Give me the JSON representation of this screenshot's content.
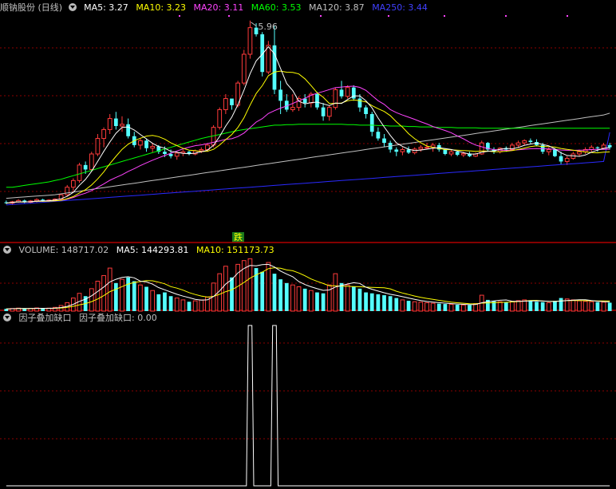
{
  "price_legend": {
    "title": "顺钠股份 (日线)",
    "ma5": "MA5: 3.27",
    "ma10": "MA10: 3.23",
    "ma20": "MA20: 3.11",
    "ma60": "MA60: 3.53",
    "ma120": "MA120: 3.87",
    "ma250": "MA250: 3.44"
  },
  "volume_legend": {
    "title": "VOLUME: 148717.02",
    "ma5": "MA5: 144293.81",
    "ma10": "MA10: 151173.73"
  },
  "factor_legend": {
    "title": "因子叠加缺口",
    "value": "因子叠加缺口: 0.00"
  },
  "annotations": {
    "peak_label": "5.96",
    "die_badge": "跌"
  },
  "colors": {
    "up": "#ff3b3b",
    "down": "#54ffff",
    "ma5": "#ffffff",
    "ma10": "#ffff00",
    "ma20": "#ff44ff",
    "ma60": "#00ff00",
    "ma120": "#c0c0c0",
    "ma250": "#2a2aff",
    "grid": "#8b0000"
  },
  "chart_data": [
    {
      "type": "candlestick",
      "title": "顺钠股份 (日线)",
      "ylim": [
        1.6,
        6.1
      ],
      "peak_high": 5.96,
      "ohlc": [
        [
          1.86,
          1.9,
          1.82,
          1.84
        ],
        [
          1.84,
          1.89,
          1.8,
          1.87
        ],
        [
          1.87,
          1.93,
          1.85,
          1.9
        ],
        [
          1.9,
          1.92,
          1.84,
          1.86
        ],
        [
          1.86,
          1.91,
          1.83,
          1.89
        ],
        [
          1.89,
          1.95,
          1.86,
          1.92
        ],
        [
          1.92,
          1.94,
          1.87,
          1.9
        ],
        [
          1.9,
          1.93,
          1.86,
          1.91
        ],
        [
          1.91,
          1.95,
          1.88,
          1.93
        ],
        [
          1.93,
          2.05,
          1.91,
          2.03
        ],
        [
          2.03,
          2.25,
          2.0,
          2.2
        ],
        [
          2.2,
          2.4,
          2.12,
          2.35
        ],
        [
          2.35,
          2.75,
          2.3,
          2.7
        ],
        [
          2.7,
          2.78,
          2.5,
          2.6
        ],
        [
          2.6,
          3.0,
          2.55,
          2.95
        ],
        [
          2.95,
          3.4,
          2.9,
          3.3
        ],
        [
          3.3,
          3.55,
          3.1,
          3.5
        ],
        [
          3.5,
          3.85,
          3.4,
          3.75
        ],
        [
          3.75,
          3.9,
          3.5,
          3.58
        ],
        [
          3.58,
          3.8,
          3.45,
          3.62
        ],
        [
          3.62,
          3.75,
          3.3,
          3.35
        ],
        [
          3.35,
          3.45,
          3.1,
          3.15
        ],
        [
          3.15,
          3.3,
          3.05,
          3.25
        ],
        [
          3.25,
          3.3,
          3.0,
          3.08
        ],
        [
          3.08,
          3.2,
          2.98,
          3.12
        ],
        [
          3.12,
          3.15,
          2.95,
          3.0
        ],
        [
          3.0,
          3.12,
          2.88,
          2.95
        ],
        [
          2.95,
          3.05,
          2.85,
          2.9
        ],
        [
          2.9,
          3.0,
          2.82,
          2.97
        ],
        [
          2.97,
          3.05,
          2.9,
          3.0
        ],
        [
          3.0,
          3.02,
          2.92,
          2.95
        ],
        [
          2.95,
          3.05,
          2.92,
          3.02
        ],
        [
          3.02,
          3.1,
          2.97,
          3.05
        ],
        [
          3.05,
          3.2,
          3.0,
          3.15
        ],
        [
          3.15,
          3.6,
          3.1,
          3.55
        ],
        [
          3.55,
          4.0,
          3.5,
          3.95
        ],
        [
          3.95,
          4.3,
          3.85,
          4.2
        ],
        [
          4.2,
          4.1,
          3.95,
          4.05
        ],
        [
          4.05,
          4.6,
          4.0,
          4.55
        ],
        [
          4.55,
          5.3,
          4.5,
          5.2
        ],
        [
          5.2,
          5.96,
          5.1,
          5.8
        ],
        [
          5.8,
          5.9,
          5.6,
          5.65
        ],
        [
          5.65,
          5.7,
          4.7,
          4.8
        ],
        [
          4.8,
          5.5,
          4.75,
          5.4
        ],
        [
          5.4,
          5.85,
          4.3,
          4.4
        ],
        [
          4.4,
          4.6,
          3.85,
          4.15
        ],
        [
          4.15,
          4.3,
          3.9,
          3.95
        ],
        [
          3.95,
          4.3,
          3.9,
          4.0
        ],
        [
          4.0,
          4.25,
          3.92,
          4.2
        ],
        [
          4.2,
          4.3,
          4.0,
          4.1
        ],
        [
          4.1,
          4.35,
          4.0,
          4.3
        ],
        [
          4.3,
          4.35,
          3.95,
          4.0
        ],
        [
          4.0,
          4.1,
          3.7,
          3.8
        ],
        [
          3.8,
          4.05,
          3.7,
          4.0
        ],
        [
          4.0,
          4.45,
          3.95,
          4.4
        ],
        [
          4.4,
          4.6,
          4.2,
          4.25
        ],
        [
          4.25,
          4.5,
          4.2,
          4.45
        ],
        [
          4.45,
          4.5,
          4.15,
          4.2
        ],
        [
          4.2,
          4.3,
          3.9,
          4.0
        ],
        [
          4.0,
          4.05,
          3.75,
          3.85
        ],
        [
          3.85,
          3.9,
          3.35,
          3.45
        ],
        [
          3.45,
          3.55,
          3.25,
          3.3
        ],
        [
          3.3,
          3.4,
          3.1,
          3.2
        ],
        [
          3.2,
          3.25,
          2.98,
          3.05
        ],
        [
          3.05,
          3.1,
          2.9,
          3.0
        ],
        [
          3.0,
          3.1,
          2.92,
          3.05
        ],
        [
          3.05,
          3.12,
          2.95,
          2.98
        ],
        [
          2.98,
          3.1,
          2.94,
          3.06
        ],
        [
          3.06,
          3.15,
          3.0,
          3.1
        ],
        [
          3.1,
          3.2,
          3.05,
          3.1
        ],
        [
          3.1,
          3.2,
          3.0,
          3.15
        ],
        [
          3.15,
          3.2,
          3.0,
          3.05
        ],
        [
          3.05,
          3.08,
          2.92,
          2.95
        ],
        [
          2.95,
          3.05,
          2.9,
          3.0
        ],
        [
          3.0,
          3.02,
          2.9,
          2.93
        ],
        [
          2.93,
          3.0,
          2.88,
          2.96
        ],
        [
          2.96,
          3.0,
          2.88,
          2.9
        ],
        [
          2.9,
          2.98,
          2.88,
          2.95
        ],
        [
          2.95,
          3.25,
          2.93,
          3.2
        ],
        [
          3.2,
          3.22,
          3.0,
          3.05
        ],
        [
          3.05,
          3.1,
          2.95,
          3.0
        ],
        [
          3.0,
          3.1,
          2.96,
          3.08
        ],
        [
          3.08,
          3.12,
          3.0,
          3.05
        ],
        [
          3.05,
          3.2,
          3.02,
          3.15
        ],
        [
          3.15,
          3.25,
          3.1,
          3.2
        ],
        [
          3.2,
          3.28,
          3.15,
          3.25
        ],
        [
          3.25,
          3.3,
          3.18,
          3.22
        ],
        [
          3.22,
          3.28,
          3.12,
          3.15
        ],
        [
          3.15,
          3.2,
          2.95,
          3.0
        ],
        [
          3.0,
          3.1,
          2.92,
          3.05
        ],
        [
          3.05,
          3.08,
          2.88,
          2.9
        ],
        [
          2.9,
          3.0,
          2.72,
          2.78
        ],
        [
          2.78,
          2.9,
          2.7,
          2.85
        ],
        [
          2.85,
          3.0,
          2.82,
          2.95
        ],
        [
          2.95,
          3.05,
          2.9,
          3.0
        ],
        [
          3.0,
          3.1,
          2.95,
          3.05
        ],
        [
          3.05,
          3.15,
          3.0,
          3.1
        ],
        [
          3.1,
          3.12,
          3.0,
          3.08
        ],
        [
          3.08,
          3.2,
          3.05,
          3.15
        ],
        [
          3.15,
          3.2,
          3.05,
          3.1
        ]
      ],
      "series_names": [
        "MA5",
        "MA10",
        "MA20",
        "MA60",
        "MA120",
        "MA250"
      ],
      "ma60": [
        2.2,
        2.2,
        2.22,
        2.24,
        2.26,
        2.28,
        2.3,
        2.32,
        2.35,
        2.38,
        2.42,
        2.46,
        2.5,
        2.54,
        2.58,
        2.62,
        2.66,
        2.7,
        2.74,
        2.78,
        2.82,
        2.86,
        2.9,
        2.94,
        2.98,
        3.02,
        3.06,
        3.1,
        3.14,
        3.18,
        3.22,
        3.26,
        3.3,
        3.33,
        3.36,
        3.39,
        3.42,
        3.45,
        3.48,
        3.5,
        3.52,
        3.54,
        3.56,
        3.58,
        3.6,
        3.6,
        3.61,
        3.61,
        3.62,
        3.62,
        3.62,
        3.62,
        3.62,
        3.62,
        3.62,
        3.62,
        3.61,
        3.61,
        3.6,
        3.6,
        3.6,
        3.59,
        3.59,
        3.58,
        3.58,
        3.58,
        3.57,
        3.57,
        3.56,
        3.56,
        3.56,
        3.55,
        3.55,
        3.55,
        3.54,
        3.54,
        3.54,
        3.54,
        3.53,
        3.53,
        3.53,
        3.53,
        3.53,
        3.53,
        3.53,
        3.53,
        3.53,
        3.53,
        3.53,
        3.53,
        3.53,
        3.53,
        3.53,
        3.53,
        3.53,
        3.53,
        3.53,
        3.53,
        3.53,
        3.53
      ],
      "ma120": [
        1.95,
        1.96,
        1.97,
        1.98,
        1.99,
        2.0,
        2.01,
        2.02,
        2.03,
        2.05,
        2.07,
        2.09,
        2.11,
        2.13,
        2.15,
        2.17,
        2.19,
        2.21,
        2.23,
        2.25,
        2.27,
        2.29,
        2.31,
        2.33,
        2.35,
        2.37,
        2.39,
        2.41,
        2.43,
        2.45,
        2.47,
        2.49,
        2.51,
        2.53,
        2.55,
        2.57,
        2.59,
        2.61,
        2.63,
        2.65,
        2.67,
        2.69,
        2.71,
        2.73,
        2.75,
        2.77,
        2.79,
        2.81,
        2.83,
        2.85,
        2.87,
        2.89,
        2.91,
        2.93,
        2.95,
        2.97,
        2.99,
        3.01,
        3.03,
        3.05,
        3.07,
        3.09,
        3.11,
        3.13,
        3.15,
        3.17,
        3.19,
        3.21,
        3.23,
        3.25,
        3.27,
        3.29,
        3.31,
        3.33,
        3.35,
        3.37,
        3.39,
        3.41,
        3.43,
        3.45,
        3.47,
        3.49,
        3.51,
        3.53,
        3.55,
        3.57,
        3.59,
        3.61,
        3.63,
        3.65,
        3.67,
        3.69,
        3.71,
        3.73,
        3.75,
        3.77,
        3.79,
        3.81,
        3.83,
        3.87
      ],
      "ma250": [
        1.8,
        1.81,
        1.82,
        1.83,
        1.84,
        1.85,
        1.86,
        1.87,
        1.88,
        1.89,
        1.9,
        1.91,
        1.92,
        1.93,
        1.94,
        1.95,
        1.96,
        1.97,
        1.98,
        1.99,
        2.0,
        2.01,
        2.02,
        2.03,
        2.04,
        2.05,
        2.06,
        2.07,
        2.08,
        2.09,
        2.1,
        2.11,
        2.12,
        2.13,
        2.14,
        2.15,
        2.16,
        2.17,
        2.18,
        2.19,
        2.2,
        2.21,
        2.22,
        2.23,
        2.24,
        2.25,
        2.26,
        2.27,
        2.28,
        2.29,
        2.3,
        2.31,
        2.32,
        2.33,
        2.34,
        2.35,
        2.36,
        2.37,
        2.38,
        2.39,
        2.4,
        2.41,
        2.42,
        2.43,
        2.44,
        2.45,
        2.46,
        2.47,
        2.48,
        2.49,
        2.5,
        2.51,
        2.52,
        2.53,
        2.54,
        2.55,
        2.56,
        2.57,
        2.58,
        2.59,
        2.6,
        2.61,
        2.62,
        2.63,
        2.64,
        2.65,
        2.66,
        2.67,
        2.68,
        2.69,
        2.7,
        2.71,
        2.72,
        2.73,
        2.74,
        2.75,
        2.76,
        2.77,
        2.78,
        3.44
      ]
    },
    {
      "type": "bar",
      "title": "VOLUME",
      "ylim": [
        0,
        290000
      ],
      "values": [
        12000,
        14000,
        16000,
        13000,
        15000,
        17000,
        14000,
        16000,
        20000,
        30000,
        45000,
        70000,
        95000,
        80000,
        120000,
        160000,
        190000,
        230000,
        150000,
        170000,
        180000,
        160000,
        140000,
        130000,
        110000,
        90000,
        100000,
        80000,
        70000,
        60000,
        50000,
        55000,
        60000,
        75000,
        150000,
        200000,
        240000,
        180000,
        250000,
        270000,
        280000,
        230000,
        210000,
        260000,
        200000,
        170000,
        150000,
        140000,
        130000,
        120000,
        110000,
        100000,
        95000,
        140000,
        200000,
        150000,
        140000,
        130000,
        120000,
        100000,
        95000,
        90000,
        85000,
        80000,
        70000,
        60000,
        55000,
        50000,
        48000,
        45000,
        42000,
        40000,
        38000,
        36000,
        34000,
        33000,
        32000,
        40000,
        85000,
        60000,
        55000,
        50000,
        48000,
        52000,
        56000,
        60000,
        58000,
        50000,
        48000,
        45000,
        55000,
        70000,
        65000,
        60000,
        55000,
        52000,
        50000,
        48000,
        48000,
        45000
      ],
      "ma5_value": 144293.81,
      "ma10_value": 151173.73,
      "last_value": 148717.02
    },
    {
      "type": "line",
      "title": "因子叠加缺口",
      "ylim": [
        0,
        1
      ],
      "signal_days": [
        40,
        44
      ],
      "last_value": 0.0
    }
  ]
}
